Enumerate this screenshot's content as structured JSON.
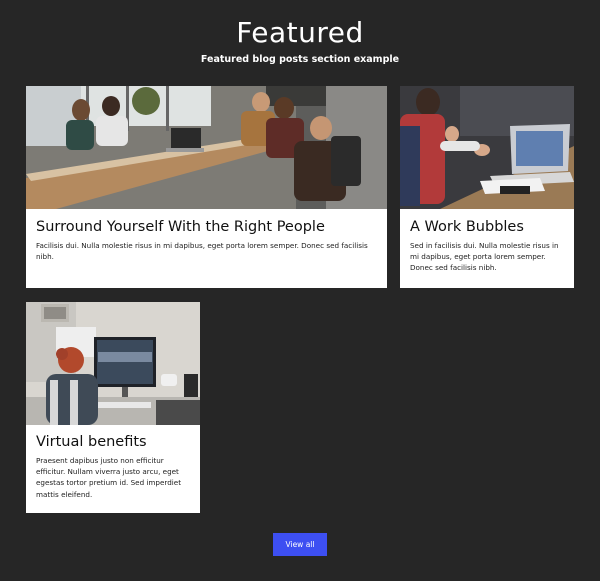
{
  "section": {
    "title": "Featured",
    "subtitle": "Featured blog posts section example"
  },
  "posts": [
    {
      "image_icon": "office-meeting-photo",
      "title": "Surround Yourself With the Right People",
      "excerpt": "Facilisis dui. Nulla molestie risus in mi dapibus, eget porta lorem semper. Donec sed facilisis nibh."
    },
    {
      "image_icon": "laptop-discussion-photo",
      "title": "A Work Bubbles",
      "excerpt": "Sed in facilisis dui. Nulla molestie risus in mi dapibus, eget porta lorem semper. Donec sed facilisis nibh."
    },
    {
      "image_icon": "desk-computer-photo",
      "title": "Virtual benefits",
      "excerpt": "Praesent dapibus justo non efficitur efficitur. Nullam viverra justo arcu, eget egestas tortor pretium id. Sed imperdiet mattis eleifend."
    }
  ],
  "view_all_label": "View all",
  "colors": {
    "background": "#262626",
    "card": "#ffffff",
    "button": "#3d4ff2"
  }
}
